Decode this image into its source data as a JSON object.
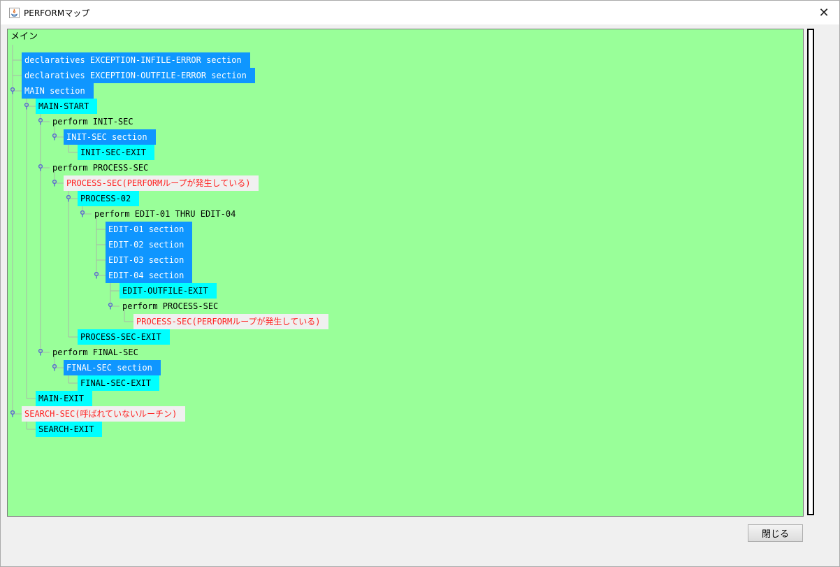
{
  "window": {
    "title": "PERFORMマップ",
    "close_glyph": "✕",
    "colors": {
      "tree_background": "#99ff99",
      "section_node": "#0f96ff",
      "paragraph_node": "#00ffff",
      "error_node_text": "#ff2020",
      "error_node_background": "#f0f0f0"
    }
  },
  "tree": {
    "root_label": "メイン",
    "nodes": [
      {
        "label": "declaratives EXCEPTION-INFILE-ERROR section",
        "kind": "sec",
        "depth": 1,
        "expanded": false
      },
      {
        "label": "declaratives EXCEPTION-OUTFILE-ERROR section",
        "kind": "sec",
        "depth": 1,
        "expanded": false
      },
      {
        "label": "MAIN section",
        "kind": "sec",
        "depth": 1,
        "expanded": true
      },
      {
        "label": "MAIN-START",
        "kind": "para",
        "depth": 2,
        "expanded": true
      },
      {
        "label": "perform INIT-SEC",
        "kind": "perf",
        "depth": 3,
        "expanded": true
      },
      {
        "label": "INIT-SEC section",
        "kind": "sec",
        "depth": 4,
        "expanded": true
      },
      {
        "label": "INIT-SEC-EXIT",
        "kind": "para",
        "depth": 5,
        "expanded": false
      },
      {
        "label": "perform PROCESS-SEC",
        "kind": "perf",
        "depth": 3,
        "expanded": true
      },
      {
        "label": "PROCESS-SEC(PERFORMループが発生している)",
        "kind": "err",
        "depth": 4,
        "expanded": true
      },
      {
        "label": "PROCESS-02",
        "kind": "para",
        "depth": 5,
        "expanded": true
      },
      {
        "label": "perform EDIT-01 THRU EDIT-04",
        "kind": "perf",
        "depth": 6,
        "expanded": true
      },
      {
        "label": "EDIT-01 section",
        "kind": "sec",
        "depth": 7,
        "expanded": false
      },
      {
        "label": "EDIT-02 section",
        "kind": "sec",
        "depth": 7,
        "expanded": false
      },
      {
        "label": "EDIT-03 section",
        "kind": "sec",
        "depth": 7,
        "expanded": false
      },
      {
        "label": "EDIT-04 section",
        "kind": "sec",
        "depth": 7,
        "expanded": true
      },
      {
        "label": "EDIT-OUTFILE-EXIT",
        "kind": "para",
        "depth": 8,
        "expanded": false
      },
      {
        "label": "perform PROCESS-SEC",
        "kind": "perf",
        "depth": 8,
        "expanded": true
      },
      {
        "label": "PROCESS-SEC(PERFORMループが発生している)",
        "kind": "err",
        "depth": 9,
        "expanded": false
      },
      {
        "label": "PROCESS-SEC-EXIT",
        "kind": "para",
        "depth": 5,
        "expanded": false
      },
      {
        "label": "perform FINAL-SEC",
        "kind": "perf",
        "depth": 3,
        "expanded": true
      },
      {
        "label": "FINAL-SEC section",
        "kind": "sec",
        "depth": 4,
        "expanded": true
      },
      {
        "label": "FINAL-SEC-EXIT",
        "kind": "para",
        "depth": 5,
        "expanded": false
      },
      {
        "label": "MAIN-EXIT",
        "kind": "para",
        "depth": 2,
        "expanded": false
      },
      {
        "label": "SEARCH-SEC(呼ばれていないルーチン)",
        "kind": "err",
        "depth": 1,
        "expanded": true
      },
      {
        "label": "SEARCH-EXIT",
        "kind": "para",
        "depth": 2,
        "expanded": false
      }
    ]
  },
  "footer": {
    "close_button_label": "閉じる"
  }
}
